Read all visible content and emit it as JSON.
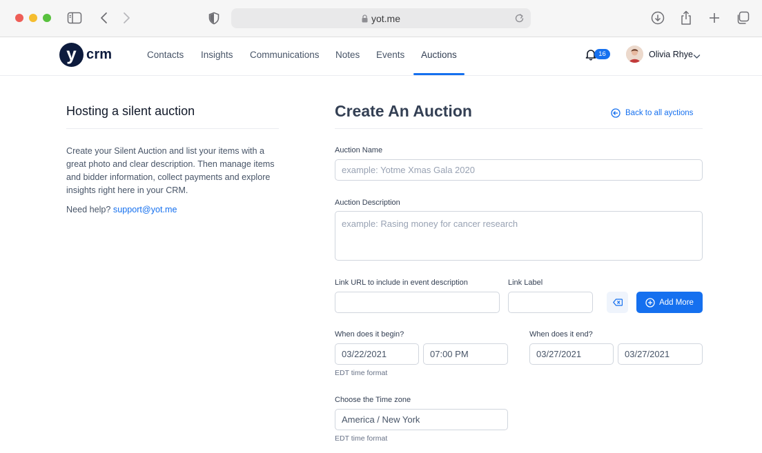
{
  "browser": {
    "url": "yot.me"
  },
  "app": {
    "logo_letter": "y",
    "logo_text": "crm",
    "nav": [
      {
        "label": "Contacts"
      },
      {
        "label": "Insights"
      },
      {
        "label": "Communications"
      },
      {
        "label": "Notes"
      },
      {
        "label": "Events"
      },
      {
        "label": "Auctions",
        "active": true
      }
    ],
    "notifications_count": "16",
    "user_name": "Olivia Rhye",
    "accent_color": "#1570ef"
  },
  "info": {
    "title": "Hosting a silent auction",
    "description": "Create your Silent Auction and list your items with a great photo and clear description. Then manage items and bidder information, collect payments and explore insights right here in your CRM.",
    "help_prefix": "Need help?",
    "help_email": "support@yot.me"
  },
  "form": {
    "title": "Create An Auction",
    "back_label": "Back to all ayctions",
    "auction_name": {
      "label": "Auction Name",
      "placeholder": "example: Yotme Xmas Gala 2020",
      "value": ""
    },
    "auction_description": {
      "label": "Auction Description",
      "placeholder": "example: Rasing money for cancer research",
      "value": ""
    },
    "link_url": {
      "label": "Link URL to include in event description",
      "value": ""
    },
    "link_label": {
      "label": "Link Label",
      "value": ""
    },
    "add_more_label": "Add More",
    "begin": {
      "label": "When does it begin?",
      "date": "03/22/2021",
      "time": "07:00 PM",
      "hint": "EDT time format"
    },
    "end": {
      "label": "When does it end?",
      "date": "03/27/2021",
      "time": "03/27/2021"
    },
    "timezone": {
      "label": "Choose the Time zone",
      "value": "America / New York",
      "hint": "EDT time format"
    }
  }
}
